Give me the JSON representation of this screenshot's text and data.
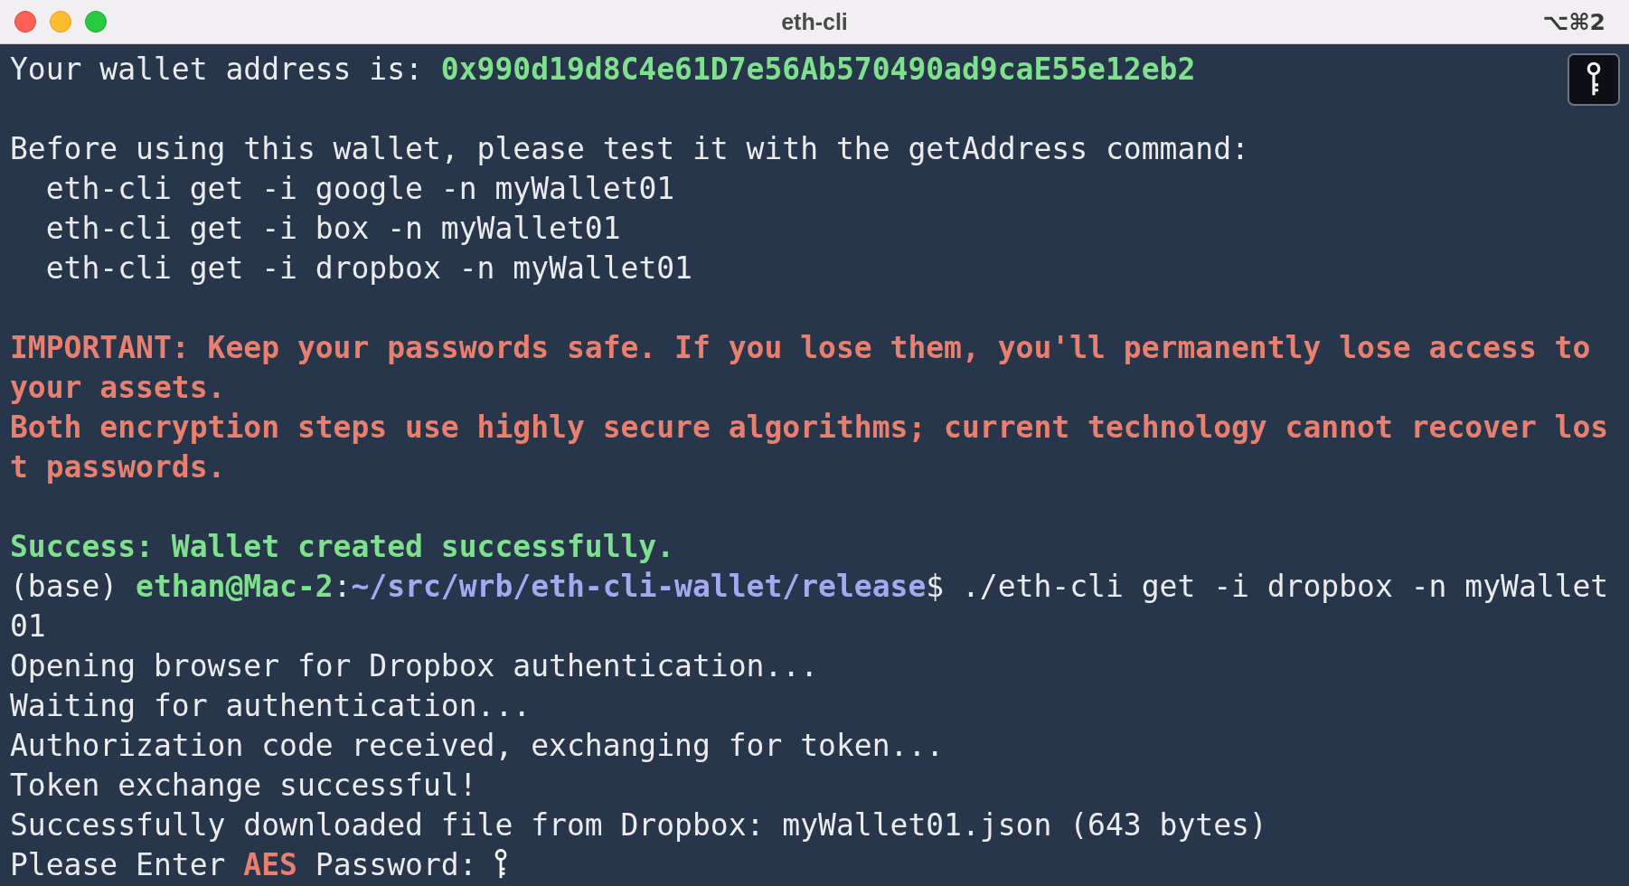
{
  "window": {
    "title": "eth-cli",
    "shortcut": "⌥⌘2"
  },
  "terminal": {
    "lines": [
      {
        "segments": [
          {
            "kind": "plain",
            "text": "Your wallet address is: "
          },
          {
            "kind": "success",
            "text": "0x990d19d8C4e61D7e56Ab570490ad9caE55e12eb2"
          }
        ]
      },
      {
        "blank_before": true,
        "segments": [
          {
            "kind": "plain",
            "text": "Before using this wallet, please test it with the getAddress command:"
          }
        ]
      },
      {
        "segments": [
          {
            "kind": "plain",
            "text": "  eth-cli get -i google -n myWallet01"
          }
        ]
      },
      {
        "segments": [
          {
            "kind": "plain",
            "text": "  eth-cli get -i box -n myWallet01"
          }
        ]
      },
      {
        "segments": [
          {
            "kind": "plain",
            "text": "  eth-cli get -i dropbox -n myWallet01"
          }
        ]
      },
      {
        "blank_before": true,
        "segments": [
          {
            "kind": "error",
            "text": "IMPORTANT: Keep your passwords safe. If you lose them, you'll permanently lose access to your assets."
          }
        ]
      },
      {
        "segments": [
          {
            "kind": "error",
            "text": "Both encryption steps use highly secure algorithms; current technology cannot recover lost passwords."
          }
        ]
      },
      {
        "blank_before": true,
        "segments": [
          {
            "kind": "success",
            "text": "Success: Wallet created successfully."
          }
        ]
      },
      {
        "segments": [
          {
            "kind": "plain",
            "text": "(base) "
          },
          {
            "kind": "user",
            "text": "ethan@Mac-2"
          },
          {
            "kind": "plain",
            "text": ":"
          },
          {
            "kind": "path",
            "text": "~/src/wrb/eth-cli-wallet/release"
          },
          {
            "kind": "plain",
            "text": "$ ./eth-cli get -i dropbox -n myWallet"
          }
        ]
      },
      {
        "segments": [
          {
            "kind": "plain",
            "text": "01"
          }
        ]
      },
      {
        "segments": [
          {
            "kind": "plain",
            "text": "Opening browser for Dropbox authentication..."
          }
        ]
      },
      {
        "segments": [
          {
            "kind": "plain",
            "text": "Waiting for authentication..."
          }
        ]
      },
      {
        "segments": [
          {
            "kind": "plain",
            "text": "Authorization code received, exchanging for token..."
          }
        ]
      },
      {
        "segments": [
          {
            "kind": "plain",
            "text": "Token exchange successful!"
          }
        ]
      },
      {
        "segments": [
          {
            "kind": "plain",
            "text": "Successfully downloaded file from Dropbox: myWallet01.json (643 bytes)"
          }
        ]
      },
      {
        "segments": [
          {
            "kind": "plain",
            "text": "Please Enter "
          },
          {
            "kind": "error",
            "text": "AES"
          },
          {
            "kind": "plain",
            "text": " Password: "
          }
        ]
      }
    ]
  }
}
